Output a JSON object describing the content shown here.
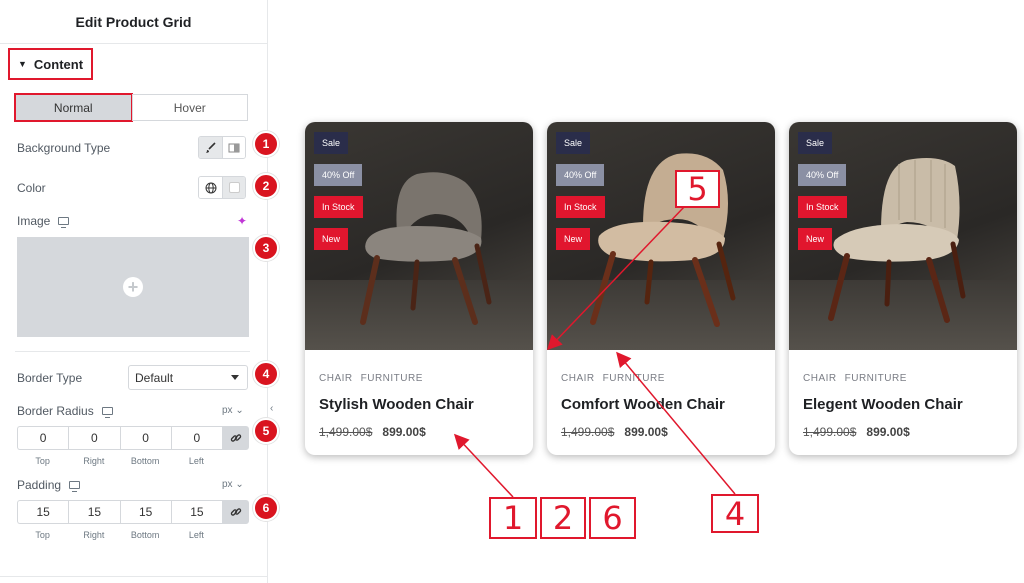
{
  "panel": {
    "title": "Edit Product Grid",
    "section": "Content",
    "tabs": [
      "Normal",
      "Hover"
    ],
    "background_type_label": "Background Type",
    "color_label": "Color",
    "image_label": "Image",
    "border_type_label": "Border Type",
    "border_type_value": "Default",
    "border_radius_label": "Border Radius",
    "border_radius_unit": "px",
    "border_radius_values": [
      "0",
      "0",
      "0",
      "0"
    ],
    "padding_label": "Padding",
    "padding_unit": "px",
    "padding_values": [
      "15",
      "15",
      "15",
      "15"
    ],
    "dim_labels": [
      "Top",
      "Right",
      "Bottom",
      "Left"
    ],
    "badges": [
      "1",
      "2",
      "3",
      "4",
      "5",
      "6"
    ]
  },
  "products": [
    {
      "tags": [
        "Sale",
        "40% Off",
        "In Stock",
        "New"
      ],
      "categories": [
        "CHAIR",
        "FURNITURE"
      ],
      "title": "Stylish Wooden Chair",
      "old_price": "1,499.00$",
      "price": "899.00$"
    },
    {
      "tags": [
        "Sale",
        "40% Off",
        "In Stock",
        "New"
      ],
      "categories": [
        "CHAIR",
        "FURNITURE"
      ],
      "title": "Comfort Wooden Chair",
      "old_price": "1,499.00$",
      "price": "899.00$"
    },
    {
      "tags": [
        "Sale",
        "40% Off",
        "In Stock",
        "New"
      ],
      "categories": [
        "CHAIR",
        "FURNITURE"
      ],
      "title": "Elegent Wooden Chair",
      "old_price": "1,499.00$",
      "price": "899.00$"
    }
  ],
  "annotations": {
    "box_1": "1",
    "box_2": "2",
    "box_6": "6",
    "box_4": "4",
    "box_5": "5"
  },
  "colors": {
    "accent_red": "#e0182d",
    "sale_tag": "#2a2d4a",
    "off_tag": "#8b90a4",
    "stock_tag": "#e1162e"
  }
}
